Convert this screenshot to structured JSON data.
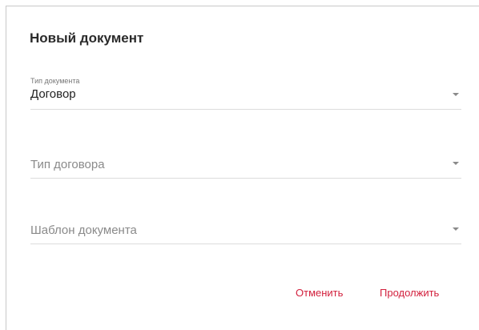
{
  "dialog": {
    "title": "Новый документ",
    "fields": [
      {
        "label": "Тип документа",
        "value": "Договор",
        "placeholder": ""
      },
      {
        "label": "",
        "value": "",
        "placeholder": "Тип договора"
      },
      {
        "label": "",
        "value": "",
        "placeholder": "Шаблон документа"
      }
    ],
    "actions": {
      "cancel_label": "Отменить",
      "continue_label": "Продолжить"
    }
  },
  "colors": {
    "accent": "#d21f3c",
    "text_primary": "#222222",
    "text_secondary": "#8a8a8a",
    "divider": "#dcdcdc"
  }
}
